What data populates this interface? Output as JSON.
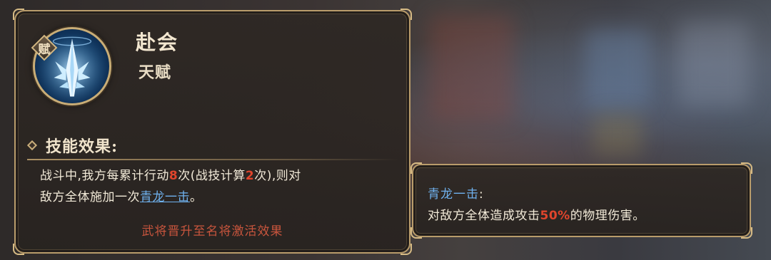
{
  "skill": {
    "badge": "赋",
    "name": "赴会",
    "type": "天赋",
    "icon": "ice-sword-icon"
  },
  "effect": {
    "heading": "技能效果:",
    "line1_a": "战斗中,我方每累计行动",
    "line1_num1": "8",
    "line1_b": "次(战技计算",
    "line1_num2": "2",
    "line1_c": "次),则对",
    "line2_a": "敌方全体施加一次",
    "line2_link": "青龙一击",
    "line2_b": "。",
    "unlock_note": "武将晋升至名将激活效果"
  },
  "tooltip": {
    "title": "青龙一击",
    "title_colon": ":",
    "desc_a": "对敌方全体造成攻击",
    "desc_pct": "50%",
    "desc_b": "的物理伤害。"
  },
  "colors": {
    "highlight_red": "#e0452c",
    "link_blue": "#6fb1ee",
    "frame_gold": "#b99c6b",
    "note_red": "#c9553d"
  }
}
